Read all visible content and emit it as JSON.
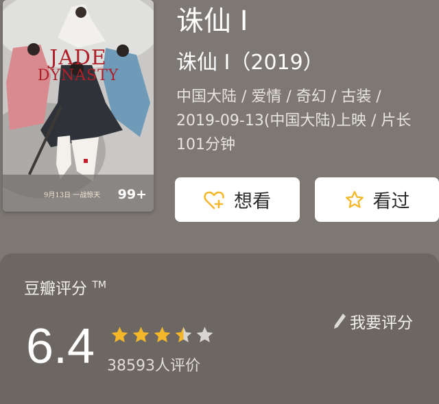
{
  "poster": {
    "brand_line1": "JADE",
    "brand_line2": "DYNASTY",
    "date_text": "9月13日 一战惊天",
    "badge": "99+"
  },
  "movie": {
    "title": "诛仙 I",
    "subtitle": "诛仙 I（2019）",
    "meta_line1": "中国大陆 / 爱情 / 奇幻 / 古装 /",
    "meta_line2": "2019-09-13(中国大陆)上映 / 片长",
    "meta_line3": "101分钟"
  },
  "actions": {
    "want_label": "想看",
    "seen_label": "看过"
  },
  "rating": {
    "label": "豆瓣评分",
    "tm": "TM",
    "my_rate_label": "我要评分",
    "score": "6.4",
    "stars": 3.5,
    "votes": "38593人评价"
  },
  "colors": {
    "background": "#7d7873",
    "card": "#6c6762",
    "star": "#f5b72a",
    "star_empty": "#d8d6d3"
  }
}
